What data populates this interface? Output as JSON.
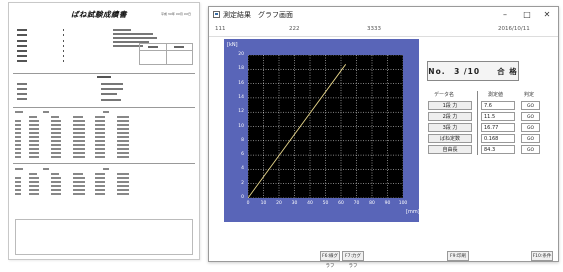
{
  "report": {
    "title": "ばね試験成績書",
    "date": "平成 3X年 XX月 XX日"
  },
  "window": {
    "title": "測定結果　グラフ画面",
    "controls": {
      "minimize": "–",
      "maximize": "□",
      "close": "✕"
    },
    "subheader": [
      "111",
      "222",
      "3333",
      "2016/10/11"
    ]
  },
  "graph": {
    "y_unit": "[kN]",
    "x_unit": "[mm]",
    "y_ticks": [
      "20",
      "18",
      "16",
      "14",
      "12",
      "10",
      "8",
      "6",
      "4",
      "2",
      "0"
    ],
    "x_ticks": [
      "0",
      "10",
      "20",
      "30",
      "40",
      "50",
      "60",
      "70",
      "80",
      "90",
      "100"
    ],
    "line_color": "#e6d58a",
    "grid_color": "#ffffff",
    "panel_color": "#5965b8"
  },
  "counter": {
    "text": "No.　3 /10　　合 格"
  },
  "results": {
    "headers": [
      "データ名",
      "測定値",
      "判定"
    ],
    "rows": [
      {
        "label": "1段 力",
        "value": "7.6",
        "judge": "GO"
      },
      {
        "label": "2段 力",
        "value": "11.5",
        "judge": "GO"
      },
      {
        "label": "3段 力",
        "value": "16.77",
        "judge": "GO"
      },
      {
        "label": "ばね定数",
        "value": "0.168",
        "judge": "GO"
      },
      {
        "label": "自由長",
        "value": "84.3",
        "judge": "GO"
      }
    ]
  },
  "footer_buttons": [
    "F6:線グラフ",
    "F7:力グラフ",
    "F9:印刷",
    "F10:条件"
  ]
}
